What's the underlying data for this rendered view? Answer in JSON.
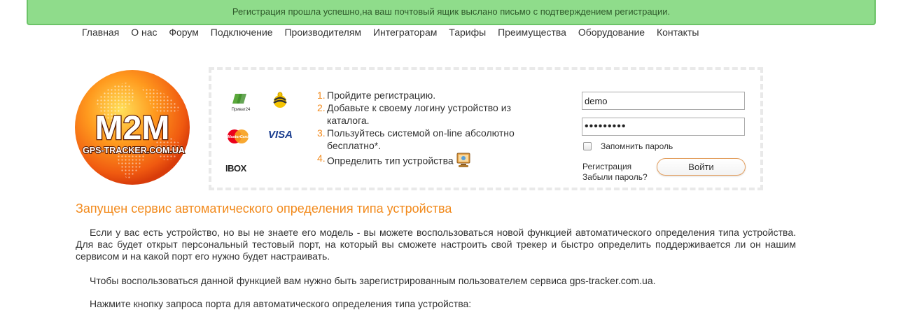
{
  "alert": {
    "text": "Регистрация прошла успешно,на ваш почтовый ящик выслано письмо с подтверждением регистрации."
  },
  "nav": {
    "items": [
      "Главная",
      "О нас",
      "Форум",
      "Подключение",
      "Производителям",
      "Интеграторам",
      "Тарифы",
      "Преимущества",
      "Оборудование",
      "Контакты"
    ]
  },
  "logo": {
    "title": "M2M",
    "subtitle": "GPS-TRACKER.COM.UA"
  },
  "payments": {
    "privat": "Приват24",
    "mastercard": "MasterCard",
    "visa": "VISA",
    "ibox": "IBOX"
  },
  "steps": [
    {
      "num": "1.",
      "text": "Пройдите регистрацию."
    },
    {
      "num": "2.",
      "text": "Добавьте к своему логину устройство из каталога."
    },
    {
      "num": "3.",
      "text": "Пользуйтесь системой on-line абсолютно бесплатно*."
    },
    {
      "num": "4.",
      "text": "Определить тип устройства"
    }
  ],
  "login": {
    "username": "demo",
    "password_mask": "•••••••••",
    "remember_label": "Запомнить пароль",
    "register_link": "Регистрация",
    "forgot_link": "Забыли пароль?",
    "submit_label": "Войти"
  },
  "article": {
    "headline": "Запущен сервис автоматического определения типа устройства",
    "p1": "Если у вас есть устройство, но вы не знаете его модель - вы можете воспользоваться новой функцией автоматического определения типа устройства. Для вас будет открыт персональный тестовый порт, на который вы сможете настроить свой трекер и быстро определить поддерживается ли он нашим сервисом и на какой порт его нужно будет настраивать.",
    "p2": "Чтобы воспользоваться данной функцией вам нужно быть зарегистрированным пользователем сервиса gps-tracker.com.ua.",
    "p3": "Нажмите кнопку запроса порта для автоматического определения типа устройства:"
  },
  "colors": {
    "accent": "#f28a1c",
    "alert_bg": "#8fdc8b",
    "alert_border": "#6cc368"
  }
}
